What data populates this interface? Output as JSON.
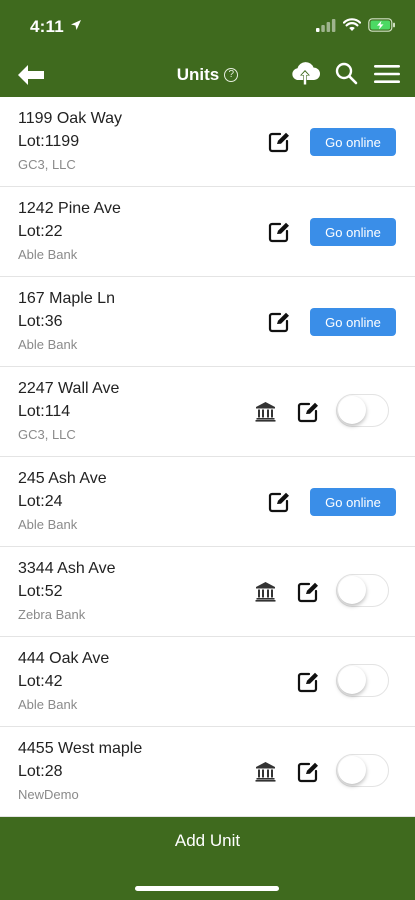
{
  "status_bar": {
    "time": "4:11"
  },
  "header": {
    "title": "Units",
    "help_glyph": "?"
  },
  "icons": {
    "back": "arrow-left-icon",
    "cloud": "cloud-upload-icon",
    "search": "search-icon",
    "menu": "hamburger-menu-icon",
    "edit": "edit-icon",
    "bank": "bank-icon"
  },
  "colors": {
    "header_bg": "#3f6a1e",
    "button_blue": "#3a8ee8"
  },
  "units": [
    {
      "address": "1199 Oak Way",
      "lot": "Lot:1199",
      "bank": "GC3, LLC",
      "action": "go_online",
      "button_label": "Go online",
      "show_bank_icon": false
    },
    {
      "address": "1242 Pine Ave",
      "lot": "Lot:22",
      "bank": "Able Bank",
      "action": "go_online",
      "button_label": "Go online",
      "show_bank_icon": false
    },
    {
      "address": "167 Maple Ln",
      "lot": "Lot:36",
      "bank": "Able Bank",
      "action": "go_online",
      "button_label": "Go online",
      "show_bank_icon": false
    },
    {
      "address": "2247 Wall Ave",
      "lot": "Lot:114",
      "bank": "GC3, LLC",
      "action": "toggle",
      "toggle_on": false,
      "show_bank_icon": true
    },
    {
      "address": "245 Ash Ave",
      "lot": "Lot:24",
      "bank": "Able Bank",
      "action": "go_online",
      "button_label": "Go online",
      "show_bank_icon": false
    },
    {
      "address": "3344 Ash Ave",
      "lot": "Lot:52",
      "bank": "Zebra Bank",
      "action": "toggle",
      "toggle_on": false,
      "show_bank_icon": true
    },
    {
      "address": "444 Oak Ave",
      "lot": "Lot:42",
      "bank": "Able Bank",
      "action": "toggle",
      "toggle_on": false,
      "show_bank_icon": false
    },
    {
      "address": "4455 West maple",
      "lot": "Lot:28",
      "bank": "NewDemo",
      "action": "toggle",
      "toggle_on": false,
      "show_bank_icon": true
    }
  ],
  "footer": {
    "add_label": "Add Unit"
  }
}
